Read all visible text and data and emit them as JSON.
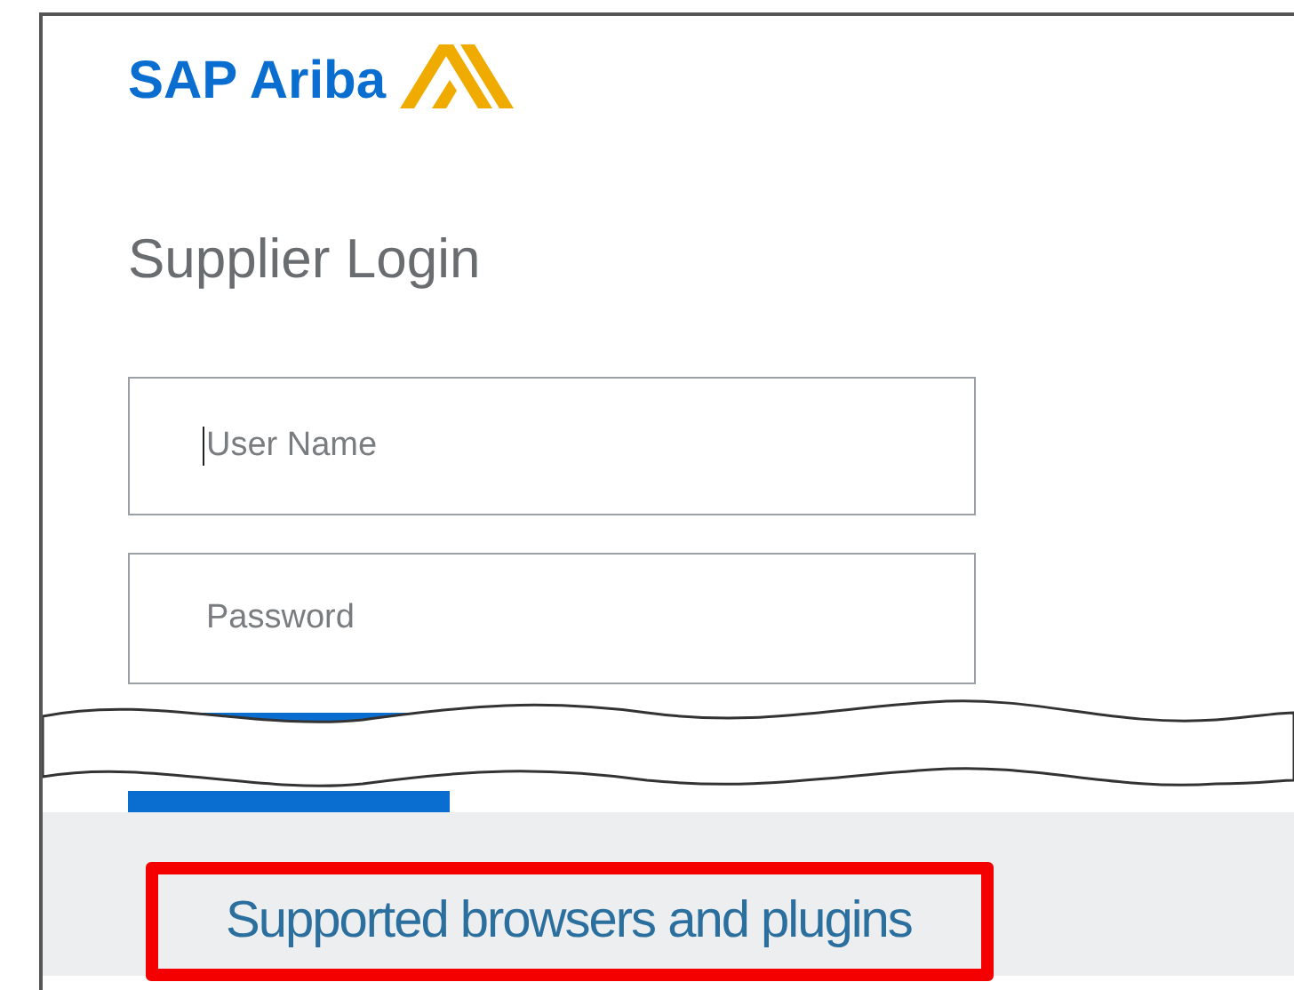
{
  "logo": {
    "text": "SAP Ariba"
  },
  "heading": "Supplier Login",
  "fields": [
    {
      "placeholder": "User Name",
      "focused": true
    },
    {
      "placeholder": "Password",
      "focused": false
    }
  ],
  "footer_link": {
    "text": "Supported browsers and plugins",
    "highlighted": true
  }
}
